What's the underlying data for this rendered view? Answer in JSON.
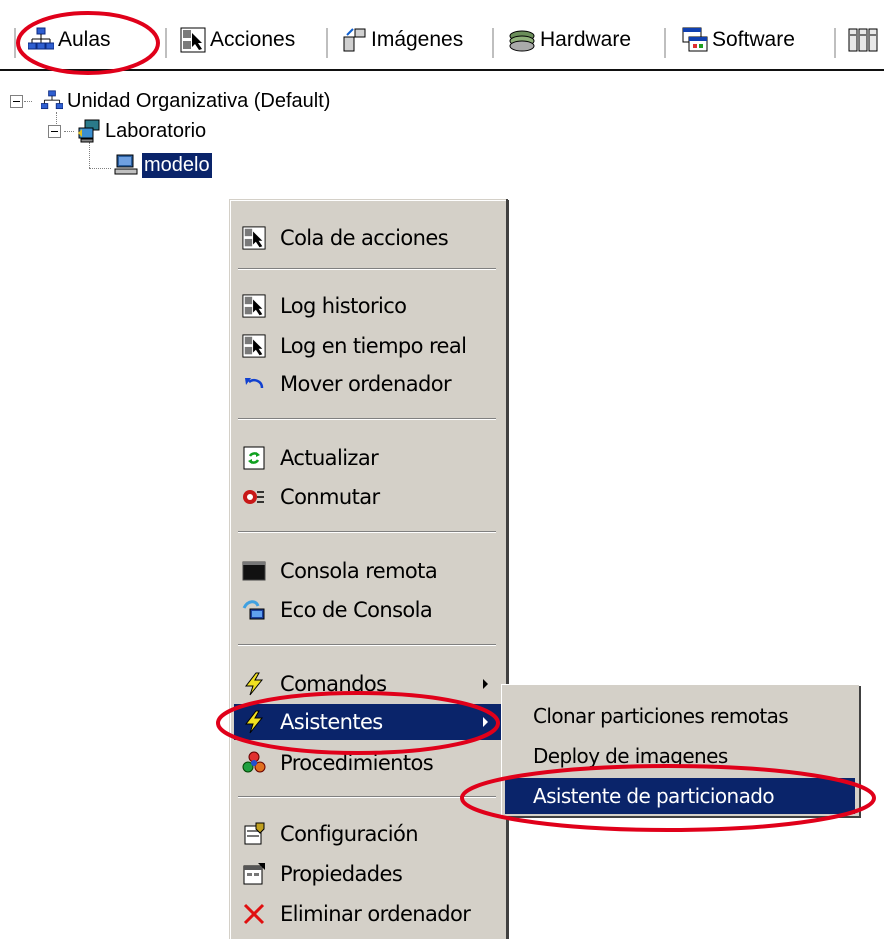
{
  "toolbar": {
    "items": [
      {
        "label": "Aulas",
        "icon": "network-icon"
      },
      {
        "label": "Acciones",
        "icon": "actions-icon"
      },
      {
        "label": "Imágenes",
        "icon": "images-icon"
      },
      {
        "label": "Hardware",
        "icon": "hardware-icon"
      },
      {
        "label": "Software",
        "icon": "software-icon"
      }
    ]
  },
  "tree": {
    "root": "Unidad Organizativa (Default)",
    "lab": "Laboratorio",
    "computer": "modelo"
  },
  "context_menu": {
    "items": {
      "cola": "Cola de acciones",
      "log_hist": "Log historico",
      "log_real": "Log en tiempo real",
      "mover": "Mover ordenador",
      "actualizar": "Actualizar",
      "conmutar": "Conmutar",
      "consola": "Consola remota",
      "eco": "Eco de Consola",
      "comandos": "Comandos",
      "asistentes": "Asistentes",
      "procedimientos": "Procedimientos",
      "configuracion": "Configuración",
      "propiedades": "Propiedades",
      "eliminar": "Eliminar ordenador"
    }
  },
  "submenu": {
    "items": {
      "clonar": "Clonar particiones remotas",
      "deploy": "Deploy de imagenes",
      "particionado": "Asistente de particionado"
    }
  },
  "colors": {
    "highlight": "#0a246a",
    "menu_bg": "#d4d0c8",
    "annotation": "#e0001a"
  }
}
